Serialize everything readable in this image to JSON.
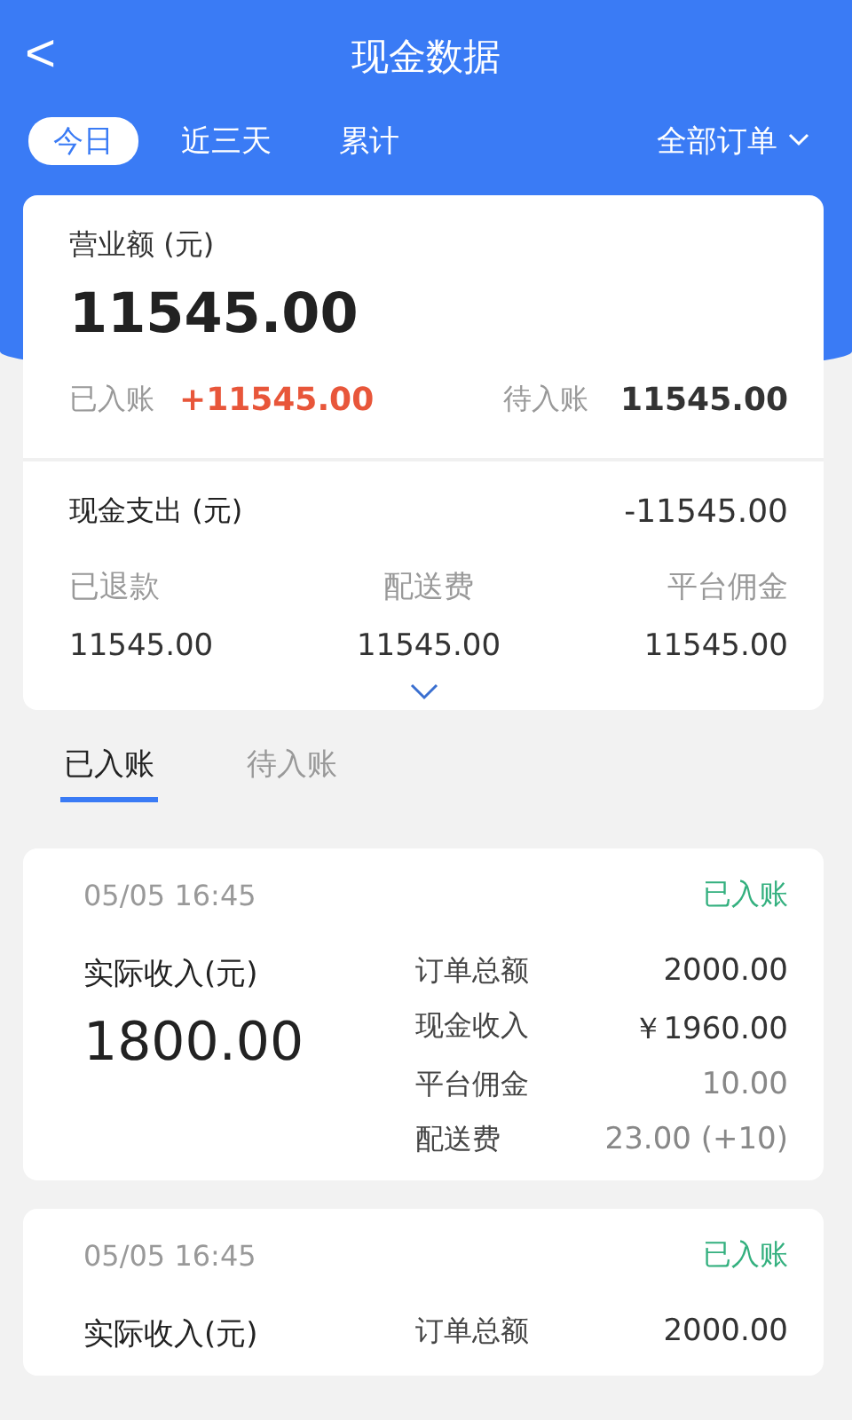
{
  "header": {
    "back": "<",
    "title": "现金数据"
  },
  "periods": [
    {
      "label": "今日",
      "selected": true
    },
    {
      "label": "近三天",
      "selected": false
    },
    {
      "label": "累计",
      "selected": false
    }
  ],
  "filter": {
    "label": "全部订单"
  },
  "summary": {
    "revenue_label": "营业额 (元)",
    "revenue": "11545.00",
    "posted_label": "已入账",
    "posted": "+11545.00",
    "pending_label": "待入账",
    "pending": "11545.00",
    "expense_label": "现金支出 (元)",
    "expense": "-11545.00",
    "expense_items": [
      {
        "label": "已退款",
        "value": "11545.00"
      },
      {
        "label": "配送费",
        "value": "11545.00"
      },
      {
        "label": "平台佣金",
        "value": "11545.00"
      }
    ],
    "expanded": false
  },
  "list_tabs": [
    {
      "label": "已入账",
      "selected": true
    },
    {
      "label": "待入账",
      "selected": false
    }
  ],
  "records": [
    {
      "time": "05/05  16:45",
      "status": "已入账",
      "income_label": "实际收入(元)",
      "income": "1800.00",
      "details": [
        {
          "label": "订单总额",
          "value": "2000.00",
          "kind": "strong"
        },
        {
          "label": "现金收入",
          "value": "￥1960.00",
          "kind": "strong"
        },
        {
          "label": "平台佣金",
          "value": "10.00",
          "kind": "muted"
        },
        {
          "label": "配送费",
          "value": "23.00 (+10)",
          "kind": "muted"
        }
      ]
    },
    {
      "time": "05/05  16:45",
      "status": "已入账",
      "income_label": "实际收入(元)",
      "details": [
        {
          "label": "订单总额",
          "value": "2000.00",
          "kind": "strong"
        }
      ]
    }
  ]
}
